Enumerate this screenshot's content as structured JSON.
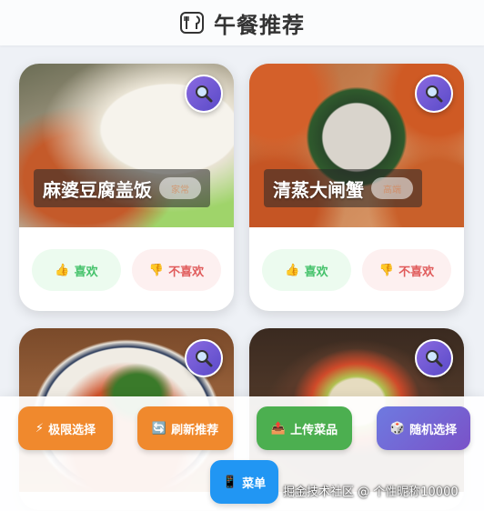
{
  "header": {
    "title": "午餐推荐",
    "icon": "fork-plate-icon"
  },
  "cards": [
    {
      "name": "麻婆豆腐盖饭",
      "tag": "家常",
      "like": "喜欢",
      "dislike": "不喜欢"
    },
    {
      "name": "清蒸大闸蟹",
      "tag": "高端",
      "like": "喜欢",
      "dislike": "不喜欢"
    },
    {
      "name": "",
      "tag": "",
      "like": "",
      "dislike": ""
    },
    {
      "name": "",
      "tag": "",
      "like": "",
      "dislike": ""
    }
  ],
  "bottom": {
    "extreme": "极限选择",
    "refresh": "刷新推荐",
    "upload": "上传菜品",
    "random": "随机选择",
    "menu": "菜单"
  },
  "watermark": "掘金技术社区 @ 个性昵称10000",
  "colors": {
    "orange": "#f0892d",
    "green": "#4caf50",
    "purple": "#7a62d6",
    "blue": "#2196f3",
    "like": "#44c26a",
    "dislike": "#e05a5a"
  }
}
